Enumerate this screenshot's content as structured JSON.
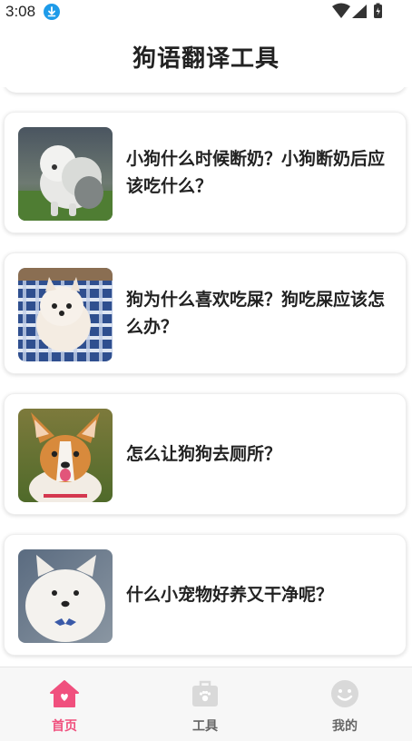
{
  "status_bar": {
    "time": "3:08",
    "icons": [
      "download-icon",
      "wifi-icon",
      "signal-icon",
      "battery-icon"
    ]
  },
  "header": {
    "title": "狗语翻译工具"
  },
  "articles": [
    {
      "title": "小狗什么时候断奶？小狗断奶后应该吃什么？",
      "thumb": "old-english-sheepdog-photo"
    },
    {
      "title": "狗为什么喜欢吃屎？狗吃屎应该怎么办？",
      "thumb": "pomeranian-photo"
    },
    {
      "title": "怎么让狗狗去厕所？",
      "thumb": "corgi-photo"
    },
    {
      "title": "什么小宠物好养又干净呢？",
      "thumb": "samoyed-puppy-photo"
    }
  ],
  "bottom_nav": {
    "items": [
      {
        "label": "首页",
        "icon": "home-icon",
        "active": true
      },
      {
        "label": "工具",
        "icon": "toolbox-icon",
        "active": false
      },
      {
        "label": "我的",
        "icon": "smiley-profile-icon",
        "active": false
      }
    ],
    "active_color": "#f0507e",
    "inactive_color": "#d8d8d8"
  }
}
